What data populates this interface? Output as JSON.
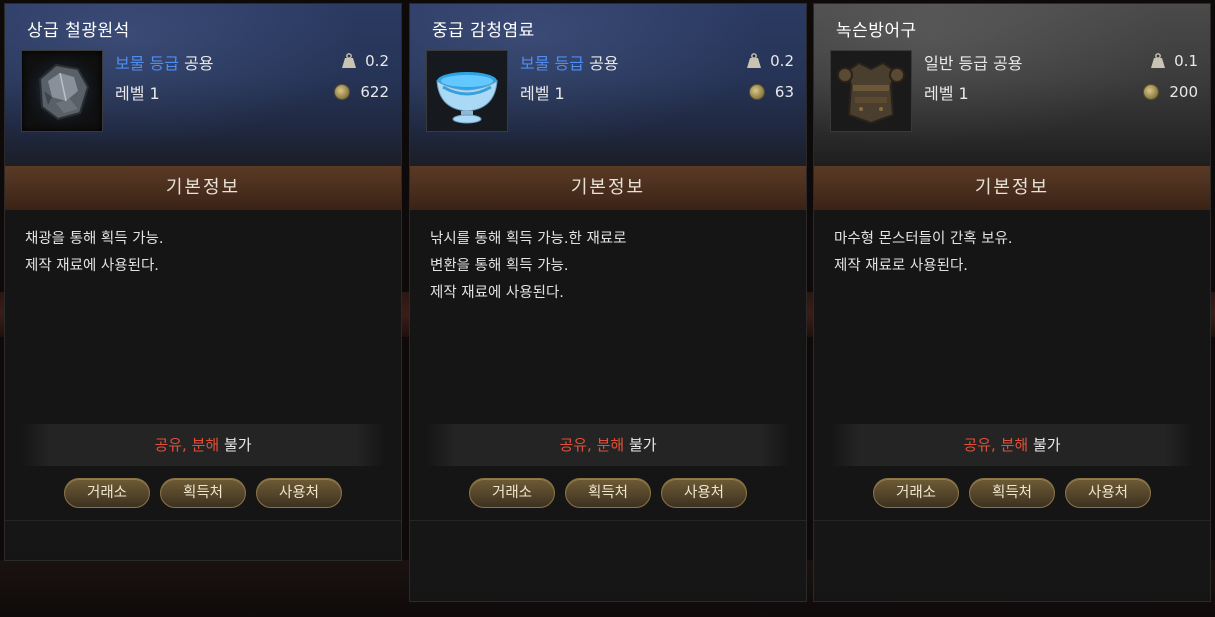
{
  "cards": [
    {
      "title": "상급 철광원석",
      "grade_prefix": "보물 등급",
      "grade_suffix": "공용",
      "level": "레벨 1",
      "weight": "0.2",
      "price": "622",
      "section": "기본정보",
      "desc": [
        "채광을 통해 획득 가능.",
        "제작 재료에 사용된다."
      ],
      "restrict_red": "공유, 분해",
      "restrict_rest": " 불가",
      "buttons": [
        "거래소",
        "획득처",
        "사용처"
      ],
      "icon": "iron-ore-icon"
    },
    {
      "title": "중급 감청염료",
      "grade_prefix": "보물 등급",
      "grade_suffix": "공용",
      "level": "레벨 1",
      "weight": "0.2",
      "price": "63",
      "section": "기본정보",
      "desc": [
        "낚시를 통해 획득 가능.한 재료로",
        "변환을 통해 획득 가능.",
        "제작 재료에 사용된다."
      ],
      "restrict_red": "공유, 분해",
      "restrict_rest": " 불가",
      "buttons": [
        "거래소",
        "획득처",
        "사용처"
      ],
      "icon": "blue-dye-bowl-icon"
    },
    {
      "title": "녹슨방어구",
      "grade_prefix": "일반 등급",
      "grade_suffix": "공용",
      "level": "레벨 1",
      "weight": "0.1",
      "price": "200",
      "section": "기본정보",
      "desc": [
        "마수형 몬스터들이 간혹 보유.",
        "제작 재료로 사용된다."
      ],
      "restrict_red": "공유, 분해",
      "restrict_rest": " 불가",
      "buttons": [
        "거래소",
        "획득처",
        "사용처"
      ],
      "icon": "rusted-armor-icon"
    }
  ],
  "colors": {
    "treasure_grade": "#4f8ef0",
    "restriction": "#e0503a",
    "section_header": "#4b2f1e"
  }
}
